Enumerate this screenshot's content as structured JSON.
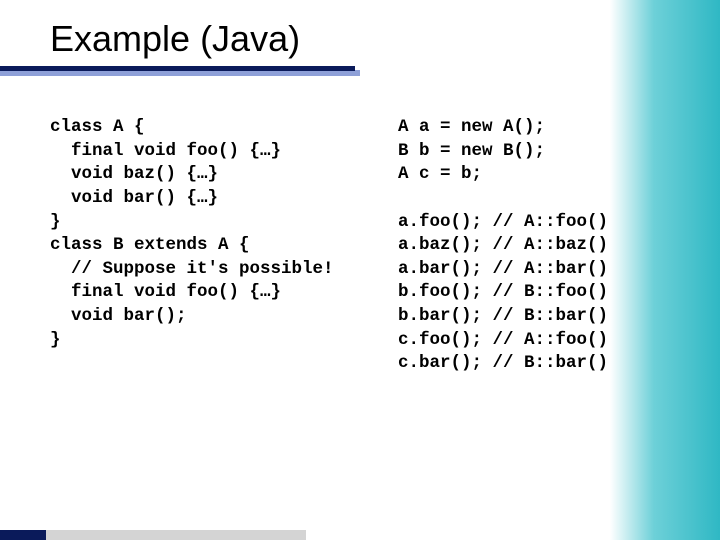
{
  "slide": {
    "title": "Example (Java)"
  },
  "code": {
    "left": "class A {\n  final void foo() {…}\n  void baz() {…}\n  void bar() {…}\n}\nclass B extends A {\n  // Suppose it's possible!\n  final void foo() {…}\n  void bar();\n}",
    "right": "A a = new A();\nB b = new B();\nA c = b;\n\na.foo(); // A::foo()\na.baz(); // A::baz()\na.bar(); // A::bar()\nb.foo(); // B::foo()\nb.bar(); // B::bar()\nc.foo(); // A::foo()\nc.bar(); // B::bar()"
  }
}
